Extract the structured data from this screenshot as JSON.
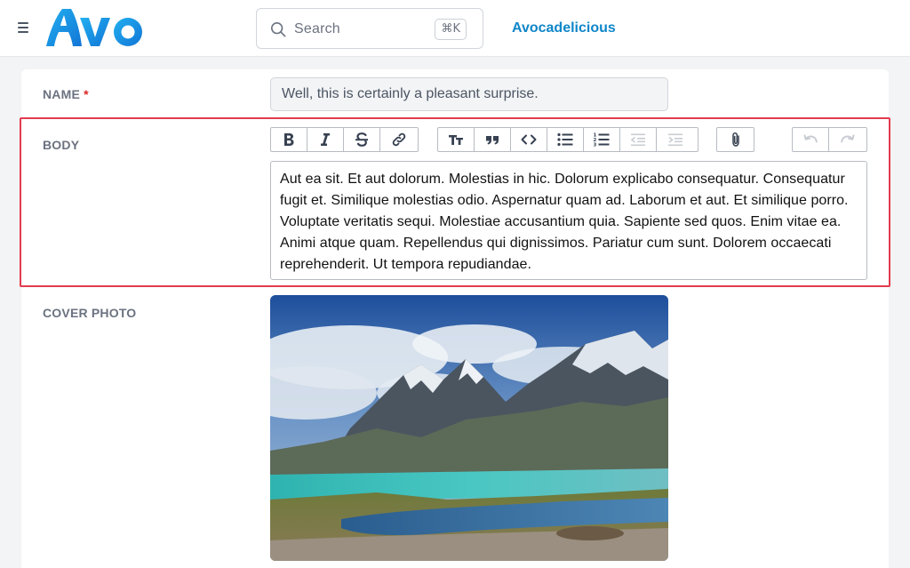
{
  "header": {
    "logo_text": "AVO",
    "search": {
      "placeholder": "Search",
      "shortcut": "⌘K"
    },
    "account_name": "Avocadelicious"
  },
  "form": {
    "name": {
      "label": "NAME",
      "required_mark": "*",
      "value": "Well, this is certainly a pleasant surprise."
    },
    "body": {
      "label": "BODY",
      "toolbar": {
        "groups": [
          [
            "bold-icon",
            "italic-icon",
            "strikethrough-icon",
            "link-icon"
          ],
          [
            "heading-icon",
            "quote-icon",
            "code-icon",
            "bullet-list-icon",
            "numbered-list-icon",
            "outdent-icon",
            "indent-icon"
          ],
          [
            "attach-icon"
          ],
          [
            "undo-icon",
            "redo-icon"
          ]
        ]
      },
      "value": "Aut ea sit. Et aut dolorum. Molestias in hic. Dolorum explicabo consequatur. Consequatur fugit et. Similique molestias odio. Aspernatur quam ad. Laborum et aut. Et similique porro. Voluptate veritatis sequi. Molestiae accusantium quia. Sapiente sed quos. Enim vitae ea. Animi atque quam. Repellendus qui dignissimos. Pariatur cum sunt. Dolorem occaecati reprehenderit. Ut tempora repudiandae."
    },
    "cover_photo": {
      "label": "COVER PHOTO"
    }
  },
  "colors": {
    "accent": "#0f86c9",
    "logo_blue": "#1aa0e8",
    "required": "#dc2626",
    "highlight": "#e23b4e"
  }
}
